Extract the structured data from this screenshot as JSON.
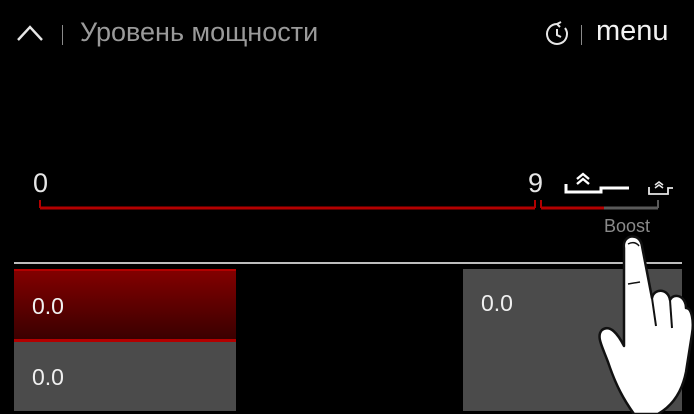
{
  "header": {
    "title": "Уровень мощности",
    "menu_label": "menu",
    "icons": {
      "back": "chevron-up-icon",
      "timer": "timer-icon"
    }
  },
  "power_scale": {
    "min_label": "0",
    "max_label": "9",
    "boost_label": "Boost",
    "icons": [
      "boost-pan-icon",
      "boost-small-pan-icon"
    ]
  },
  "zones": {
    "top_left_value": "0.0",
    "bottom_left_value": "0.0",
    "right_value": "0.0"
  },
  "colors": {
    "background": "#000000",
    "accent_red": "#b30000",
    "panel_gray": "#4b4b4b",
    "text": "#e6e6e6"
  }
}
